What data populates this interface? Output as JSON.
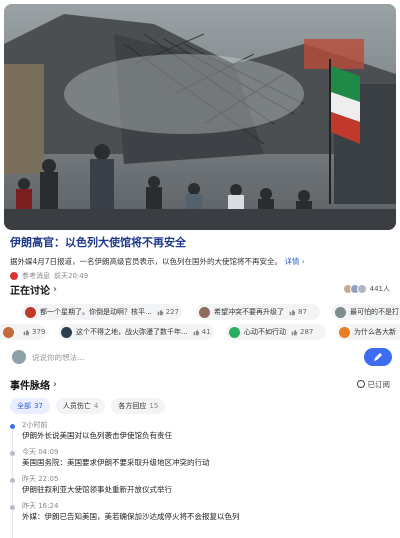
{
  "article": {
    "headline": "伊朗高官：以色列大使馆将不再安全",
    "summary": "据外媒4月7日报道，一名伊朗高级官员表示，以色列在国外的大使馆将不再安全。",
    "detail_link": "详情",
    "detail_chevron": "›",
    "source_name": "参考消息",
    "source_time": "前天20:49"
  },
  "discussion": {
    "title": "正在讨论",
    "chevron": "›",
    "participants": "441人",
    "row1": [
      {
        "text": "都一个星期了。你倒是动啊？核平...",
        "likes": "227",
        "avatar_color": "#c0392b"
      },
      {
        "text": "希望冲突不要再升级了",
        "likes": "87",
        "avatar_color": "#8e6b5a"
      },
      {
        "text": "最可怕的不是打",
        "likes": "",
        "avatar_color": "#7f8c8d"
      }
    ],
    "row2": [
      {
        "text": "",
        "likes": "379",
        "avatar_color": "#c06b3b"
      },
      {
        "text": "这个不得之地，战火弥漫了数千年...",
        "likes": "41",
        "avatar_color": "#2c3e50"
      },
      {
        "text": "心动不如行动",
        "likes": "287",
        "avatar_color": "#27ae60"
      },
      {
        "text": "为什么各大新",
        "likes": "",
        "avatar_color": "#e67e22"
      }
    ]
  },
  "compose": {
    "placeholder": "说说你的想法..."
  },
  "timeline": {
    "title": "事件脉络",
    "chevron": "›",
    "follow_label": "已订阅",
    "tabs": [
      {
        "label": "全部",
        "count": "37"
      },
      {
        "label": "人员伤亡",
        "count": "4"
      },
      {
        "label": "各方回应",
        "count": "15"
      }
    ],
    "events": [
      {
        "time": "2小时前",
        "text": "伊朗外长说美国对以色列袭击伊使馆负有责任"
      },
      {
        "time": "今天 04:09",
        "text": "美国国务院：美国要求伊朗不要采取升级地区冲突的行动"
      },
      {
        "time": "昨天 22:05",
        "text": "伊朗驻叙利亚大使馆领事处重新开放仪式举行"
      },
      {
        "time": "昨天 16:24",
        "text": "外媒：伊朗已告知美国，美若确保加沙达成停火将不会报复以色列"
      }
    ]
  },
  "colors": {
    "accent": "#3c6df0",
    "headline": "#1f3a8a"
  }
}
